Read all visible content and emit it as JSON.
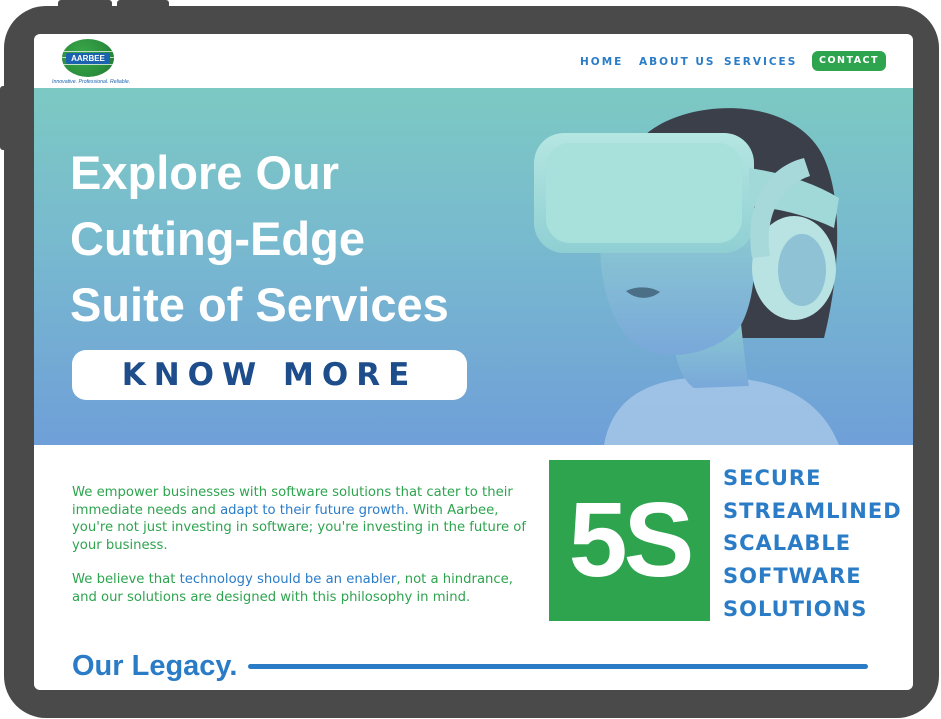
{
  "brand": {
    "name": "AARBEE",
    "tagline": "Innovative. Professional. Reliable."
  },
  "nav": {
    "home": "HOME",
    "about": "ABOUT US",
    "services": "SERVICES",
    "contact": "CONTACT"
  },
  "hero": {
    "title_lines": [
      "Explore Our",
      "Cutting-Edge",
      "Suite of Services"
    ],
    "cta": "KNOW MORE"
  },
  "intro": {
    "p1_a": "We empower businesses with software solutions that cater to their immediate needs and ",
    "p1_highlight": "adapt to their future growth.",
    "p1_b": " With Aarbee, you're not just investing in software; you're investing in the future of your business.",
    "p2_a": "We believe that ",
    "p2_highlight": "technology should be an enabler",
    "p2_b": ", not a hindrance, and our solutions are designed with this philosophy in mind."
  },
  "five_s": {
    "badge": "5S",
    "items": [
      "SECURE",
      "STREAMLINED",
      "SCALABLE",
      "SOFTWARE",
      "SOLUTIONS"
    ]
  },
  "legacy": {
    "title": "Our Legacy."
  },
  "colors": {
    "frame": "#4a4a4a",
    "green": "#2ea44f",
    "blue": "#2a7cc7",
    "navy": "#1e4d8c",
    "hero_top": "#7cc9c3",
    "hero_bottom": "#6f9fd8"
  }
}
